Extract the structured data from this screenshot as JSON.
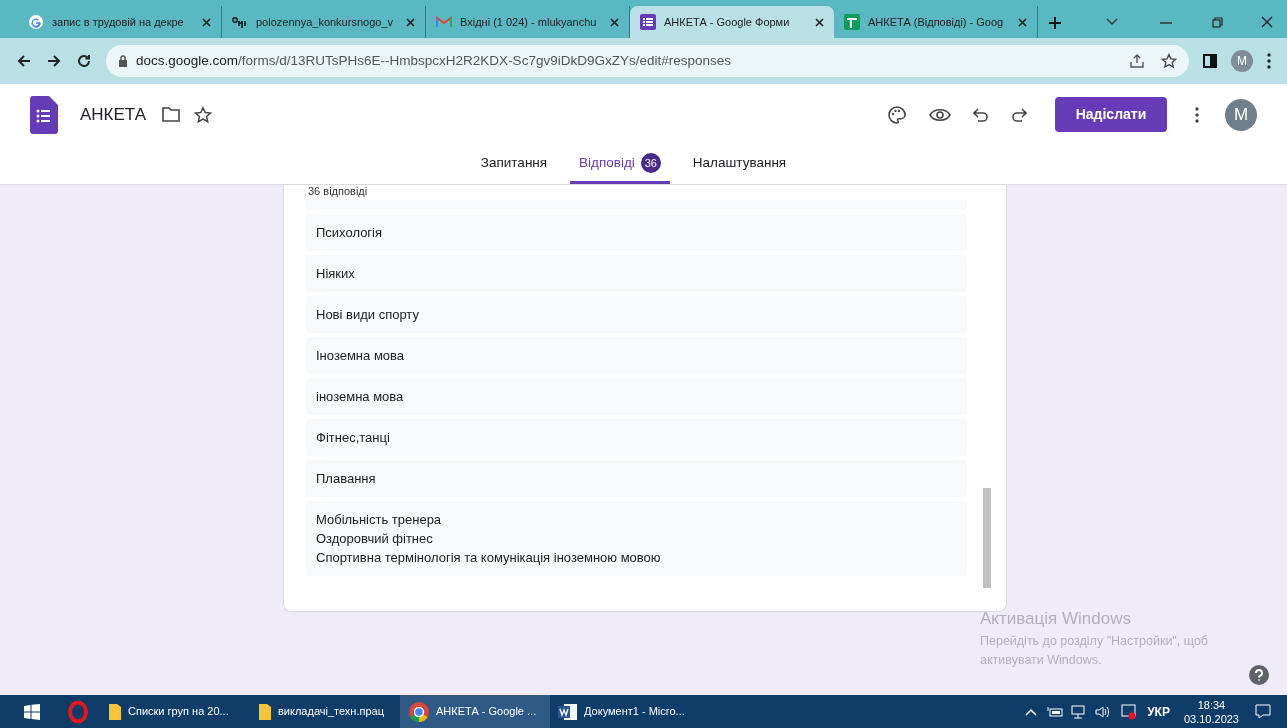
{
  "browser": {
    "tabs": [
      {
        "title": "запис в трудовій на декре",
        "kind": "google",
        "selected": false
      },
      {
        "title": "polozennya_konkursnogo_v",
        "kind": "doc",
        "selected": false
      },
      {
        "title": "Вхідні (1 024) - mlukyanchu",
        "kind": "mail",
        "selected": false
      },
      {
        "title": "АНКЕТА - Google Форми",
        "kind": "forms",
        "selected": true
      },
      {
        "title": "АНКЕТА (Відповіді) - Goog",
        "kind": "sheets",
        "selected": false
      }
    ],
    "url_domain": "docs.google.com",
    "url_path": "/forms/d/13RUTsPHs6E--HmbspcxH2R2KDX-Sc7gv9iDkD9GxZYs/edit#responses",
    "profile": "M"
  },
  "form": {
    "title": "АНКЕТА",
    "send_button": "Надіслати",
    "avatar": "M",
    "tabs": [
      {
        "label": "Запитання",
        "selected": false
      },
      {
        "label": "Відповіді",
        "selected": true,
        "badge": "36"
      },
      {
        "label": "Налаштування",
        "selected": false
      }
    ]
  },
  "responses": {
    "summary": "36 відповіді",
    "answers": [
      {
        "lines": [
          "Психологія"
        ]
      },
      {
        "lines": [
          "Ніяких"
        ]
      },
      {
        "lines": [
          "Нові види спорту"
        ]
      },
      {
        "lines": [
          "Іноземна мова"
        ]
      },
      {
        "lines": [
          "іноземна мова"
        ]
      },
      {
        "lines": [
          "Фітнес,танці"
        ]
      },
      {
        "lines": [
          "Плавання"
        ]
      },
      {
        "lines": [
          "Мобільність тренера",
          "Оздоровчий фітнес",
          "Спортивна термінологія та комунікація іноземною мовою"
        ]
      }
    ]
  },
  "activation": {
    "title": "Активація Windows",
    "text": "Перейдіть до розділу \"Настройки\", щоб активувати Windows."
  },
  "taskbar": {
    "items": [
      {
        "label": "Списки груп на  20...",
        "kind": "folder",
        "active": false
      },
      {
        "label": "викладачі_техн.прац",
        "kind": "folder",
        "active": false
      },
      {
        "label": "АНКЕТА - Google ...",
        "kind": "chrome",
        "active": true
      },
      {
        "label": "Документ1 - Micro...",
        "kind": "word",
        "active": false
      }
    ],
    "language": "УКР",
    "time": "18:34",
    "date": "03.10.2023"
  }
}
